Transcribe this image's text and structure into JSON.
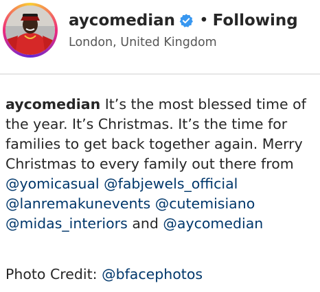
{
  "header": {
    "username": "aycomedian",
    "separator": "•",
    "follow_status": "Following",
    "location": "London, United Kingdom",
    "avatar_icon": "profile-avatar",
    "verified_icon": "verified-badge-icon",
    "verified_color": "#3897f0"
  },
  "caption": {
    "author": "aycomedian",
    "line1_text": " It’s the most blessed time of",
    "line2_text": "the year. It’s Christmas. It’s the time for",
    "line3_text": "families to get back together again. Merry",
    "line4_text": "Christmas to every family out there from",
    "mentions": [
      "@yomicasual",
      "@fabjewels_official",
      "@lanremakunevents",
      "@cutemisiano",
      "@midas_interiors",
      "@aycomedian"
    ],
    "and_text": " and ",
    "credit_label": "Photo Credit: ",
    "credit_mention": "@bfacephotos"
  },
  "colors": {
    "text": "#262626",
    "mention": "#00376b",
    "location": "#555555"
  }
}
